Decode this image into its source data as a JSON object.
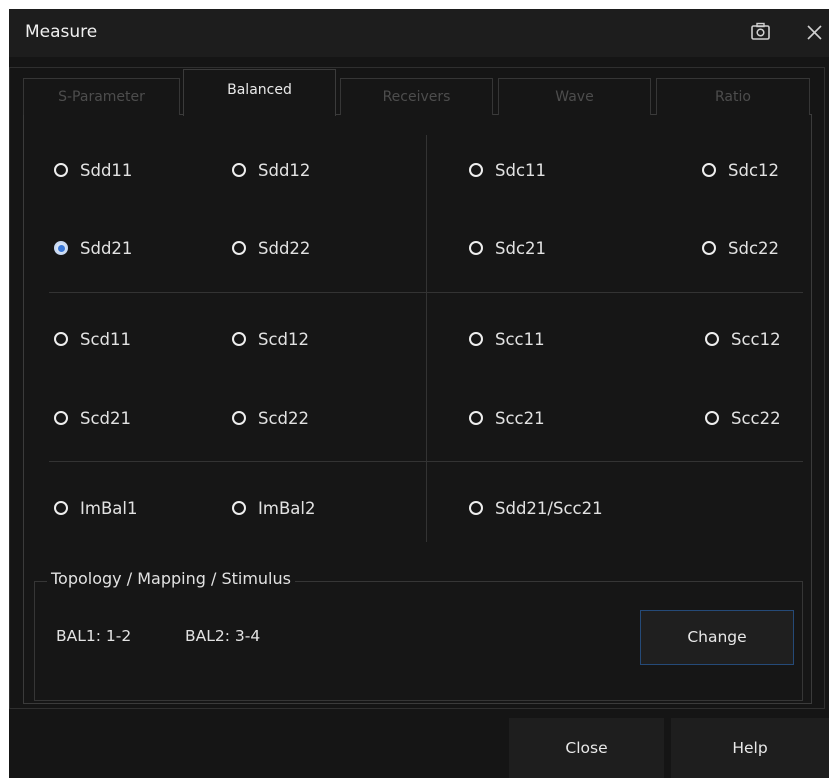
{
  "dialog": {
    "title": "Measure",
    "camera_icon": "camera-icon",
    "close_icon": "close-icon"
  },
  "tabs": [
    {
      "label": "S-Parameter",
      "active": false
    },
    {
      "label": "Balanced",
      "active": true
    },
    {
      "label": "Receivers",
      "active": false
    },
    {
      "label": "Wave",
      "active": false
    },
    {
      "label": "Ratio",
      "active": false
    }
  ],
  "params": {
    "sdd11": "Sdd11",
    "sdd12": "Sdd12",
    "sdc11": "Sdc11",
    "sdc12": "Sdc12",
    "sdd21": "Sdd21",
    "sdd22": "Sdd22",
    "sdc21": "Sdc21",
    "sdc22": "Sdc22",
    "scd11": "Scd11",
    "scd12": "Scd12",
    "scc11": "Scc11",
    "scc12": "Scc12",
    "scd21": "Scd21",
    "scd22": "Scd22",
    "scc21": "Scc21",
    "scc22": "Scc22",
    "imbal1": "ImBal1",
    "imbal2": "ImBal2",
    "sdd21_scc21": "Sdd21/Scc21"
  },
  "selected": "Sdd21",
  "topology": {
    "legend": "Topology / Mapping / Stimulus",
    "bal1": "BAL1: 1-2",
    "bal2": "BAL2: 3-4",
    "change_label": "Change"
  },
  "footer": {
    "close_label": "Close",
    "help_label": "Help"
  },
  "colors": {
    "background": "#151515",
    "accent": "#3a78d8",
    "text": "#e2e2e2",
    "inactive_tab_text": "#4d4d4d"
  }
}
